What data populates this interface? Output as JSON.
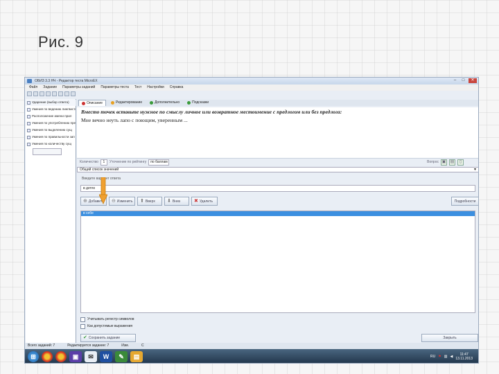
{
  "slide": {
    "caption": "Рис. 9"
  },
  "window": {
    "title": "ОБИЗ 3.3 НЧ - Редактор теста MicroEX",
    "controls": [
      "–",
      "□",
      "✕"
    ]
  },
  "menu": [
    "Файл",
    "Задание",
    "Параметры заданий",
    "Параметры теста",
    "Тест",
    "Настройки",
    "Справка"
  ],
  "tabs": [
    {
      "label": "Описание",
      "color": "#c33"
    },
    {
      "label": "Редактирование",
      "color": "#e8a020"
    },
    {
      "label": "Дополнительно",
      "color": "#3a9a3a"
    },
    {
      "label": "Подсказки",
      "color": "#3a9a3a"
    }
  ],
  "left_panel": {
    "items": [
      "Ударение (выбор ответа)",
      "Умения по ведению лингвистич",
      "Расположение имени прил",
      "Умения по употреблению пред",
      "Умения по выделению сущ",
      "Умения по правильности зап",
      "Умения по количеству сущ"
    ]
  },
  "question": {
    "line1": "Вместо точек вставьте нужное по смыслу личное или возвратное местоимение с предлогом или без предлога:",
    "line2": "Мне вечно неуть лапо с поющим, уверенным ..."
  },
  "score_bar": {
    "label_points": "Количество",
    "points": "1",
    "label_weight": "Уточнение по рейтингу",
    "weight": "по баллам",
    "label_right": "Вопрос"
  },
  "type_select": {
    "value": "Общий список значений"
  },
  "answer": {
    "label": "Введите вариант ответа",
    "input_value": "в детях"
  },
  "buttons": {
    "add": "Добавить",
    "edit": "Изменить",
    "up": "Вверх",
    "down": "Вниз",
    "delete": "Удалить",
    "import": "Подробности",
    "save": "Сохранить задание",
    "ok": "Закрыть"
  },
  "answers_list": [
    "в себе"
  ],
  "options": {
    "opt1": "Учитывать регистр символов",
    "opt2": "Как допустимые выражения"
  },
  "status_bar": [
    "Всего заданий: 7",
    "Редактируется задание: 7",
    "Изм.",
    "С"
  ],
  "taskbar": {
    "lang": "RU",
    "time": "11:47",
    "date": "13.11.2013"
  }
}
